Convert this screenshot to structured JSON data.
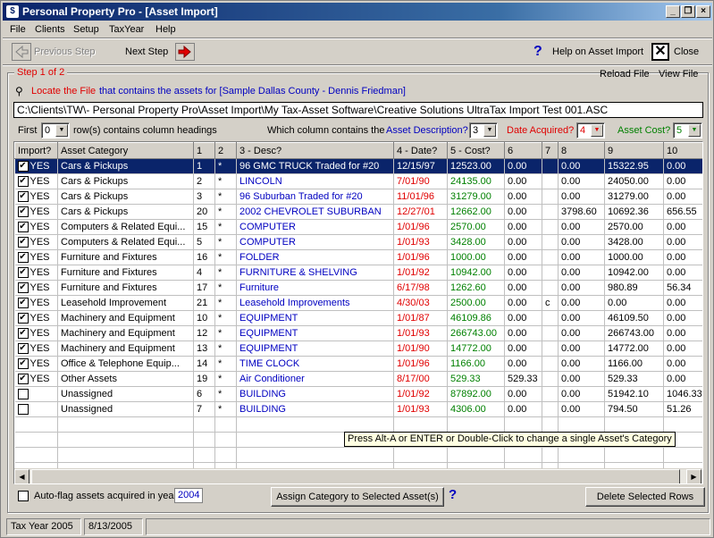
{
  "window": {
    "title": "Personal Property Pro - [Asset Import]"
  },
  "menu": [
    "File",
    "Clients",
    "Setup",
    "TaxYear",
    "Help"
  ],
  "toolbar": {
    "previous_step": "Previous Step",
    "next_step": "Next Step",
    "help": "Help on Asset Import",
    "close": "Close"
  },
  "step": {
    "label": "Step 1 of 2",
    "reload": "Reload File",
    "view": "View File"
  },
  "locate": {
    "prefix": "Locate the File",
    "rest": "that contains the assets for [Sample Dallas County - Dennis Friedman]"
  },
  "file_path": "C:\\Clients\\TW\\- Personal Property Pro\\Asset Import\\My Tax-Asset Software\\Creative Solutions UltraTax Import Test 001.ASC",
  "options": {
    "first_label": "First",
    "first_value": "0",
    "rows_label": "row(s) contains column headings",
    "which_label": "Which column contains the",
    "desc_label": "Asset Description?",
    "desc_value": "3",
    "date_label": "Date Acquired?",
    "date_value": "4",
    "cost_label": "Asset Cost?",
    "cost_value": "5"
  },
  "columns": [
    "Import?",
    "Asset Category",
    "1",
    "2",
    "3 - Desc?",
    "4 - Date?",
    "5 - Cost?",
    "6",
    "7",
    "8",
    "9",
    "10"
  ],
  "rows": [
    {
      "imp": "YES",
      "cat": "Cars & Pickups",
      "c1": "1",
      "c2": "*",
      "desc": "96 GMC TRUCK Traded for #20",
      "date": "12/15/97",
      "cost": "12523.00",
      "c6": "0.00",
      "c7": "",
      "c8": "0.00",
      "c9": "15322.95",
      "c10": "0.00",
      "selected": true
    },
    {
      "imp": "YES",
      "cat": "Cars & Pickups",
      "c1": "2",
      "c2": "*",
      "desc": "LINCOLN",
      "date": "7/01/90",
      "cost": "24135.00",
      "c6": "0.00",
      "c7": "",
      "c8": "0.00",
      "c9": "24050.00",
      "c10": "0.00"
    },
    {
      "imp": "YES",
      "cat": "Cars & Pickups",
      "c1": "3",
      "c2": "*",
      "desc": "96 Suburban Traded for #20",
      "date": "11/01/96",
      "cost": "31279.00",
      "c6": "0.00",
      "c7": "",
      "c8": "0.00",
      "c9": "31279.00",
      "c10": "0.00"
    },
    {
      "imp": "YES",
      "cat": "Cars & Pickups",
      "c1": "20",
      "c2": "*",
      "desc": "2002 CHEVROLET SUBURBAN",
      "date": "12/27/01",
      "cost": "12662.00",
      "c6": "0.00",
      "c7": "",
      "c8": "3798.60",
      "c9": "10692.36",
      "c10": "656.55"
    },
    {
      "imp": "YES",
      "cat": "Computers & Related Equi...",
      "c1": "15",
      "c2": "*",
      "desc": "COMPUTER",
      "date": "1/01/96",
      "cost": "2570.00",
      "c6": "0.00",
      "c7": "",
      "c8": "0.00",
      "c9": "2570.00",
      "c10": "0.00"
    },
    {
      "imp": "YES",
      "cat": "Computers & Related Equi...",
      "c1": "5",
      "c2": "*",
      "desc": "COMPUTER",
      "date": "1/01/93",
      "cost": "3428.00",
      "c6": "0.00",
      "c7": "",
      "c8": "0.00",
      "c9": "3428.00",
      "c10": "0.00"
    },
    {
      "imp": "YES",
      "cat": "Furniture and Fixtures",
      "c1": "16",
      "c2": "*",
      "desc": "FOLDER",
      "date": "1/01/96",
      "cost": "1000.00",
      "c6": "0.00",
      "c7": "",
      "c8": "0.00",
      "c9": "1000.00",
      "c10": "0.00"
    },
    {
      "imp": "YES",
      "cat": "Furniture and Fixtures",
      "c1": "4",
      "c2": "*",
      "desc": "FURNITURE & SHELVING",
      "date": "1/01/92",
      "cost": "10942.00",
      "c6": "0.00",
      "c7": "",
      "c8": "0.00",
      "c9": "10942.00",
      "c10": "0.00"
    },
    {
      "imp": "YES",
      "cat": "Furniture and Fixtures",
      "c1": "17",
      "c2": "*",
      "desc": "Furniture",
      "date": "6/17/98",
      "cost": "1262.60",
      "c6": "0.00",
      "c7": "",
      "c8": "0.00",
      "c9": "980.89",
      "c10": "56.34"
    },
    {
      "imp": "YES",
      "cat": "Leasehold Improvement",
      "c1": "21",
      "c2": "*",
      "desc": "Leasehold Improvements",
      "date": "4/30/03",
      "cost": "2500.00",
      "c6": "0.00",
      "c7": "c",
      "c8": "0.00",
      "c9": "0.00",
      "c10": "0.00"
    },
    {
      "imp": "YES",
      "cat": "Machinery and Equipment",
      "c1": "10",
      "c2": "*",
      "desc": "EQUIPMENT",
      "date": "1/01/87",
      "cost": "46109.86",
      "c6": "0.00",
      "c7": "",
      "c8": "0.00",
      "c9": "46109.50",
      "c10": "0.00"
    },
    {
      "imp": "YES",
      "cat": "Machinery and Equipment",
      "c1": "12",
      "c2": "*",
      "desc": "EQUIPMENT",
      "date": "1/01/93",
      "cost": "266743.00",
      "c6": "0.00",
      "c7": "",
      "c8": "0.00",
      "c9": "266743.00",
      "c10": "0.00"
    },
    {
      "imp": "YES",
      "cat": "Machinery and Equipment",
      "c1": "13",
      "c2": "*",
      "desc": "EQUIPMENT",
      "date": "1/01/90",
      "cost": "14772.00",
      "c6": "0.00",
      "c7": "",
      "c8": "0.00",
      "c9": "14772.00",
      "c10": "0.00"
    },
    {
      "imp": "YES",
      "cat": "Office & Telephone Equip...",
      "c1": "14",
      "c2": "*",
      "desc": "TIME CLOCK",
      "date": "1/01/96",
      "cost": "1166.00",
      "c6": "0.00",
      "c7": "",
      "c8": "0.00",
      "c9": "1166.00",
      "c10": "0.00"
    },
    {
      "imp": "YES",
      "cat": "Other Assets",
      "c1": "19",
      "c2": "*",
      "desc": "Air Conditioner",
      "date": "8/17/00",
      "cost": "529.33",
      "c6": "529.33",
      "c7": "",
      "c8": "0.00",
      "c9": "529.33",
      "c10": "0.00"
    },
    {
      "imp": "",
      "cat": "Unassigned",
      "c1": "6",
      "c2": "*",
      "desc": "BUILDING",
      "date": "1/01/92",
      "cost": "87892.00",
      "c6": "0.00",
      "c7": "",
      "c8": "0.00",
      "c9": "51942.10",
      "c10": "1046.33"
    },
    {
      "imp": "",
      "cat": "Unassigned",
      "c1": "7",
      "c2": "*",
      "desc": "BUILDING",
      "date": "1/01/93",
      "cost": "4306.00",
      "c6": "0.00",
      "c7": "",
      "c8": "0.00",
      "c9": "794.50",
      "c10": "51.26"
    }
  ],
  "tooltip": "Press Alt-A or ENTER or Double-Click to change a single Asset's Category",
  "bottom": {
    "autoflag_label": "Auto-flag assets acquired in year",
    "autoflag_year": "2004",
    "assign": "Assign Category to Selected Asset(s)",
    "delete": "Delete Selected Rows"
  },
  "status": {
    "taxyear": "Tax Year 2005",
    "date": "8/13/2005"
  }
}
